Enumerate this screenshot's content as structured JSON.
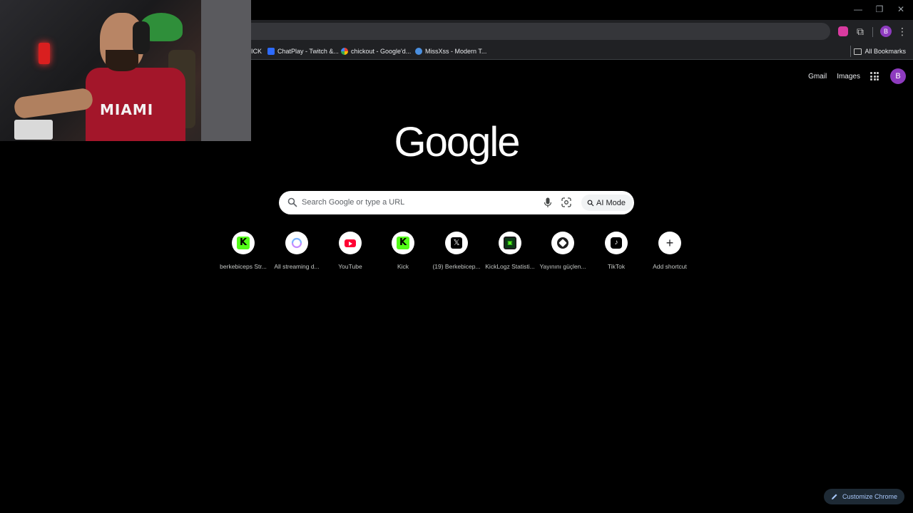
{
  "window": {
    "minimize_glyph": "—",
    "maximize_glyph": "❐",
    "close_glyph": "✕"
  },
  "toolbar": {
    "profile_initial": "B",
    "menu_glyph": "⋮",
    "extensions_glyph": "⧉"
  },
  "bookmarks": {
    "items": [
      {
        "label": "ICK",
        "favicon_color": ""
      },
      {
        "label": "ChatPlay - Twitch &...",
        "favicon_color": "#2d6bff"
      },
      {
        "label": "chickout - Google'd...",
        "favicon_color": "#ea4335"
      },
      {
        "label": "MissXss - Modern T...",
        "favicon_color": "#4a8fe0"
      }
    ],
    "all_bookmarks": "All Bookmarks"
  },
  "header": {
    "gmail": "Gmail",
    "images": "Images",
    "account_initial": "B"
  },
  "logo": "Google",
  "search": {
    "placeholder": "Search Google or type a URL",
    "ai_mode": "AI Mode"
  },
  "shortcuts": [
    {
      "label": "berkebiceps Str...",
      "icon": "kick-icon"
    },
    {
      "label": "All streaming d...",
      "icon": "streaming-icon"
    },
    {
      "label": "YouTube",
      "icon": "youtube-icon"
    },
    {
      "label": "Kick",
      "icon": "kick-icon"
    },
    {
      "label": "(19) Berkebicep...",
      "icon": "x-icon"
    },
    {
      "label": "KickLogz Statisti...",
      "icon": "kicklogz-icon"
    },
    {
      "label": "Yayınını güçlen...",
      "icon": "shield-icon"
    },
    {
      "label": "TikTok",
      "icon": "tiktok-icon"
    },
    {
      "label": "Add shortcut",
      "icon": "plus-icon"
    }
  ],
  "webcam": {
    "shirt_text": "MIAMI"
  },
  "customize": "Customize Chrome",
  "colors": {
    "background": "#000000",
    "kick_green": "#53fc18",
    "profile_purple": "#8e3bbf",
    "youtube_red": "#ff0033",
    "customize_text": "#a8c7fa"
  }
}
